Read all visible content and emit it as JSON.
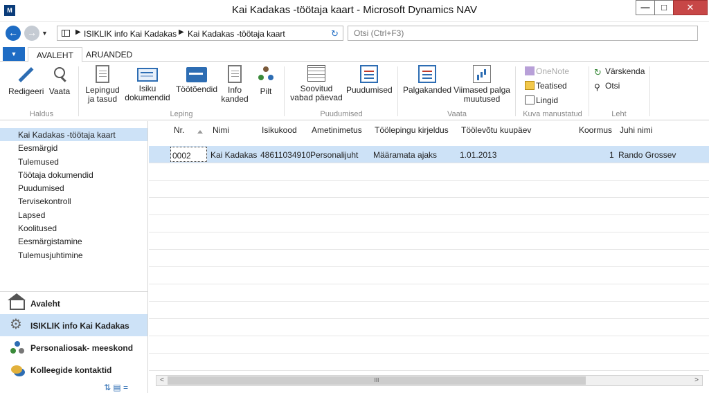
{
  "window": {
    "title": "Kai Kadakas -töötaja kaart - Microsoft Dynamics NAV",
    "logo_text": "M",
    "minimize": "—",
    "maximize": "□",
    "close": "✕"
  },
  "address": {
    "crumbs": [
      "ISIKLIK info Kai Kadakas",
      "Kai Kadakas -töötaja kaart"
    ],
    "separator": "▶",
    "search_placeholder": "Otsi (Ctrl+F3)"
  },
  "ribbon_tabs": [
    "AVALEHT",
    "ARUANDED"
  ],
  "ribbon": {
    "groups": {
      "haldus": "Haldus",
      "leping": "Leping",
      "puudumised": "Puudumised",
      "vaata": "Vaata",
      "kuva_manustatud": "Kuva manustatud",
      "leht": "Leht"
    },
    "buttons": {
      "redigeeri": "Redigeeri",
      "vaata": "Vaata",
      "lepingud_1": "Lepingud",
      "lepingud_2": "ja tasud",
      "isiku_1": "Isiku",
      "isiku_2": "dokumendid",
      "tootoendid": "Töötõendid",
      "info_1": "Info",
      "info_2": "kanded",
      "pilt": "Pilt",
      "soovitud_1": "Soovitud",
      "soovitud_2": "vabad päevad",
      "puudumised": "Puudumised",
      "palgakanded": "Palgakanded",
      "viimased_1": "Viimased palga",
      "viimased_2": "muutused",
      "onenote": "OneNote",
      "teatised": "Teatised",
      "lingid": "Lingid",
      "varskenda": "Värskenda",
      "otsi": "Otsi"
    }
  },
  "leftnav": {
    "items": [
      "Kai Kadakas -töötaja kaart",
      "Eesmärgid",
      "Tulemused",
      "Töötaja dokumendid",
      "Puudumised",
      "Tervisekontroll",
      "Lapsed",
      "Koolitused",
      "Eesmärgistamine",
      "Tulemusjuhtimine"
    ],
    "centers": [
      "Avaleht",
      "ISIKLIK info Kai Kadakas",
      "Personaliosak-  meeskond",
      "Kolleegide kontaktid"
    ],
    "bottom_tools": "⇅  ▤  ="
  },
  "grid": {
    "columns": {
      "nr": "Nr.",
      "nimi": "Nimi",
      "isikukood": "Isikukood",
      "ametinimetus": "Ametinimetus",
      "kirjeldus": "Töölepingu kirjeldus",
      "kuupaev": "Töölevõtu kuupäev",
      "koormus": "Koormus",
      "juhi_nimi": "Juhi nimi"
    },
    "rows": [
      {
        "nr": "0002",
        "nimi": "Kai Kadakas",
        "isikukood": "48611034910",
        "ametinimetus": "Personalijuht",
        "kirjeldus": "Määramata ajaks",
        "kuupaev": "1.01.2013",
        "koormus": "1",
        "juhi_nimi": "Rando Grossev"
      }
    ],
    "scroll_left": "<",
    "scroll_right": ">",
    "scroll_thumb": "III"
  }
}
